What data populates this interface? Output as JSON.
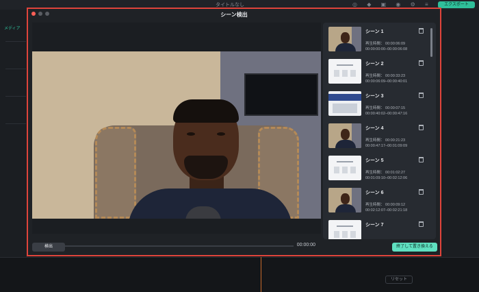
{
  "background": {
    "app_title": "タイトルなし",
    "export_label": "エクスポート",
    "media_tab": "メディア",
    "reset_label": "リセット"
  },
  "dialog": {
    "title": "シーン検出",
    "detect_button": "検出",
    "finish_button": "終了して置き換える",
    "player": {
      "timecode": "00:00:00",
      "progress": 0
    },
    "scenes": [
      {
        "name": "シーン 1",
        "thumb": "person",
        "duration": "再生時間：  00:00:06:09",
        "range": "00:00:00:00–00:00:06:08"
      },
      {
        "name": "シーン 2",
        "thumb": "doc",
        "duration": "再生時間：  00:00:33:23",
        "range": "00:00:06:09–00:00:40:01"
      },
      {
        "name": "シーン 3",
        "thumb": "web",
        "duration": "再生時間：  00:00:07:15",
        "range": "00:00:40:02–00:00:47:16"
      },
      {
        "name": "シーン 4",
        "thumb": "person",
        "duration": "再生時間：  00:00:21:23",
        "range": "00:00:47:17–00:01:09:09"
      },
      {
        "name": "シーン 5",
        "thumb": "doc",
        "duration": "再生時間：  00:01:02:27",
        "range": "00:01:09:10–00:02:12:06"
      },
      {
        "name": "シーン 6",
        "thumb": "person",
        "duration": "再生時間：  00:00:09:12",
        "range": "00:02:12:07–00:02:21:18"
      },
      {
        "name": "シーン 7",
        "thumb": "doc",
        "duration": "",
        "range": ""
      }
    ]
  },
  "colors": {
    "accent": "#5fe0c0",
    "highlight_border": "#e0443b",
    "dialog_bg": "#1f2226"
  }
}
